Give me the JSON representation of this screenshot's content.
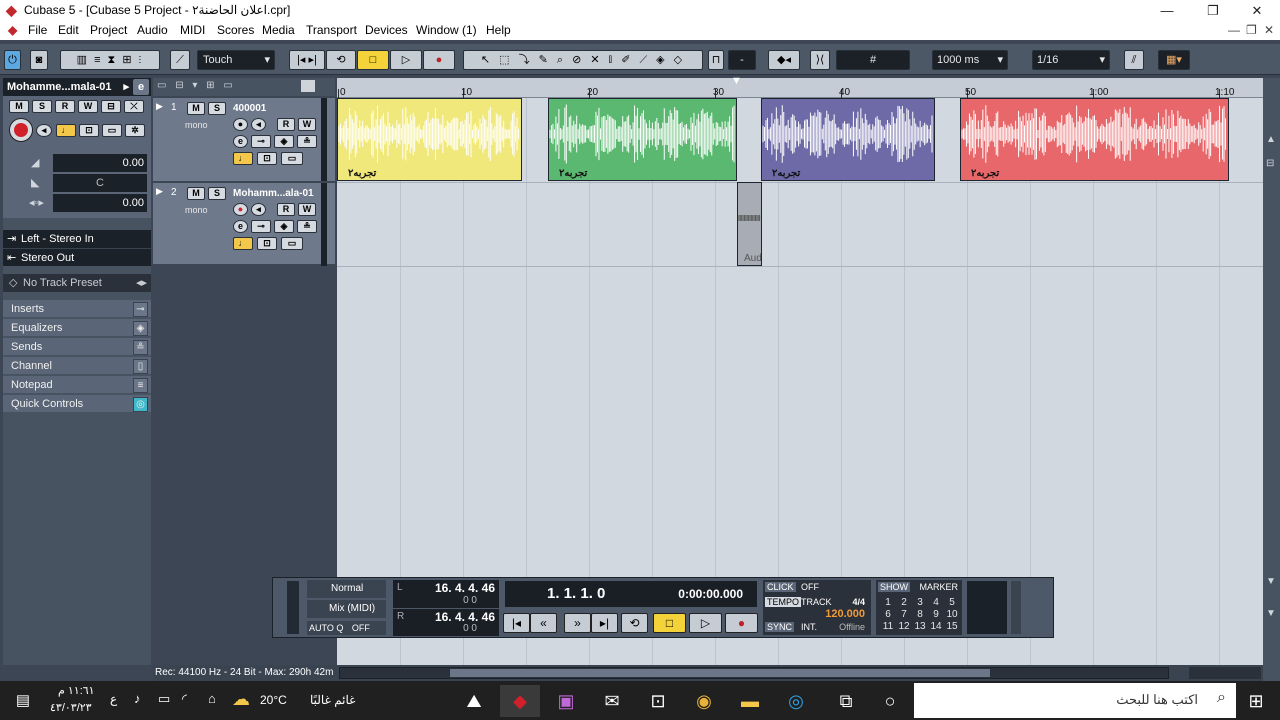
{
  "window": {
    "title": "Cubase 5 - [Cubase 5 Project - اعلان الحاضنة٢.cpr]",
    "min": "—",
    "max": "❐",
    "close": "✕"
  },
  "menu": [
    "File",
    "Edit",
    "Project",
    "Audio",
    "MIDI",
    "Scores",
    "Media",
    "Transport",
    "Devices",
    "Window (1)",
    "Help"
  ],
  "toolbar": {
    "automation_mode": "Touch",
    "snap_value": "-",
    "snap_length": "1000 ms",
    "quantize": "1/16"
  },
  "inspector": {
    "track_name": "Mohamme...mala-01",
    "volume": "0.00",
    "pan": "C",
    "delay": "0.00",
    "input": "Left - Stereo In",
    "output": "Stereo Out",
    "preset": "No Track Preset",
    "sections": [
      "Inserts",
      "Equalizers",
      "Sends",
      "Channel",
      "Notepad",
      "Quick Controls"
    ]
  },
  "tracks": [
    {
      "number": "1",
      "name": "400001",
      "mode": "mono"
    },
    {
      "number": "2",
      "name": "Mohamm...ala-01",
      "mode": "mono"
    }
  ],
  "ruler": {
    "labels": [
      "0",
      "10",
      "20",
      "30",
      "40",
      "50",
      "1:00",
      "1:10"
    ]
  },
  "events": [
    {
      "name": "تجربه٢",
      "color": "#f0e87a"
    },
    {
      "name": "تجربه٢",
      "color": "#5bb870"
    },
    {
      "name": "تجربه٢",
      "color": "#6e6aa8"
    },
    {
      "name": "تجربه٢",
      "color": "#e8676a"
    },
    {
      "name": "Aud",
      "color": "#a8adb5"
    }
  ],
  "transport": {
    "mode": "Normal",
    "mix": "Mix (MIDI)",
    "autoq": "AUTO Q",
    "autoq_state": "OFF",
    "left_locator": "16. 4. 4. 46",
    "left_sub": "0    0",
    "right_locator": "16. 4. 4. 46",
    "right_sub": "0    0",
    "position": "1. 1. 1.   0",
    "time": "0:00:00.000",
    "click": "CLICK",
    "click_state": "OFF",
    "tempo_label": "TEMPO",
    "tempo_mode": "TRACK",
    "signature": "4/4",
    "tempo": "120.000",
    "sync_label": "SYNC",
    "sync_mode": "INT.",
    "sync_state": "Offline",
    "show": "SHOW",
    "marker": "MARKER",
    "marker_numbers": [
      "1",
      "2",
      "3",
      "4",
      "5",
      "6",
      "7",
      "8",
      "9",
      "10",
      "11",
      "12",
      "13",
      "14",
      "15"
    ]
  },
  "status": "Rec: 44100 Hz - 24 Bit - Max: 290h 42m",
  "taskbar": {
    "search_placeholder": "اكتب هنا للبحث",
    "weather": "غائم غالبًا",
    "temperature": "20°C",
    "time": "١١:٦١ م",
    "date": "٤٣/٠٣/٢٣",
    "lang": "ع"
  }
}
